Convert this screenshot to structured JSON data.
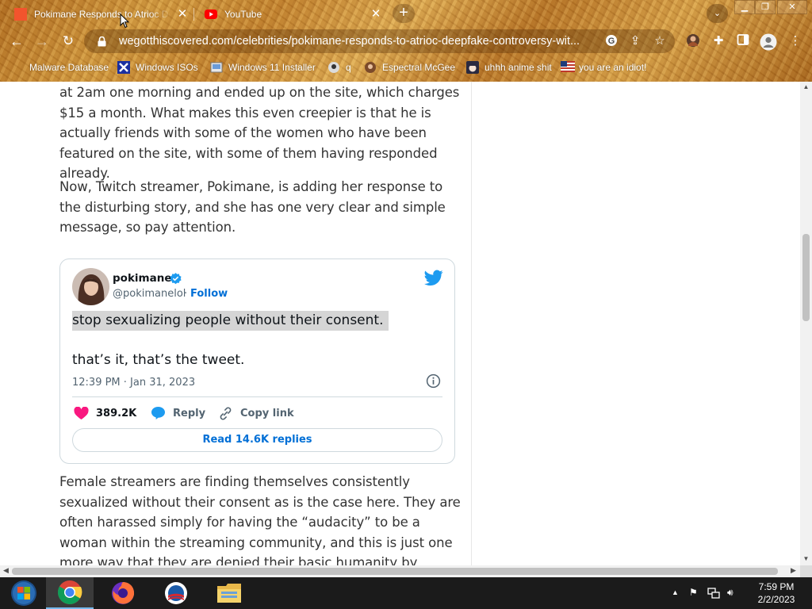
{
  "browser": {
    "tabs": [
      {
        "title": "Pokimane Responds to Atrioc Deepf",
        "active": true
      },
      {
        "title": "YouTube",
        "active": false
      }
    ],
    "url": "wegotthiscovered.com/celebrities/pokimane-responds-to-atrioc-deepfake-controversy-wit...",
    "bookmarks": [
      {
        "label": "Malware Database",
        "icon": "flame-icon"
      },
      {
        "label": "Windows ISOs",
        "icon": "x-logo-icon"
      },
      {
        "label": "Windows 11 Installer",
        "icon": "installer-icon"
      },
      {
        "label": "q",
        "icon": "anime-avatar-icon"
      },
      {
        "label": "Espectral McGee",
        "icon": "character-icon"
      },
      {
        "label": "uhhh anime shit",
        "icon": "anime-face-icon"
      },
      {
        "label": "you are an idiot!",
        "icon": "flag-icon"
      }
    ],
    "theme_color": "#c4822c"
  },
  "article": {
    "para1": "at 2am one morning and ended up on the site, which charges $15 a month. What makes this even creepier is that he is actually friends with some of the women who have been featured on the site, with some of them having responded already.",
    "para2": "Now, Twitch streamer, Pokimane, is adding her response to the disturbing story, and she has one very clear and simple message, so pay attention.",
    "para3": "Female streamers are finding themselves consistently sexualized without their consent as is the case here. They are often harassed simply for having the “audacity” to be a woman within the streaming community, and this is just one more way that they are denied their basic humanity by having these deepfakes of"
  },
  "tweet": {
    "name": "pokimane",
    "handle": "@pokimanelol",
    "separator": "·",
    "follow_label": "Follow",
    "text_line1": "stop sexualizing people without their consent.",
    "text_line2": "that’s it, that’s the tweet.",
    "timestamp": "12:39 PM · Jan 31, 2023",
    "likes": "389.2K",
    "reply_label": "Reply",
    "copy_label": "Copy link",
    "replies_label": "Read 14.6K replies",
    "colors": {
      "link": "#006fd6",
      "like": "#f91880",
      "bird": "#1d9bf0"
    }
  },
  "taskbar": {
    "apps": [
      "start-orb-icon",
      "chrome-icon",
      "firefox-icon",
      "obama-logo-icon",
      "file-explorer-icon"
    ],
    "time": "7:59 PM",
    "date": "2/2/2023"
  }
}
